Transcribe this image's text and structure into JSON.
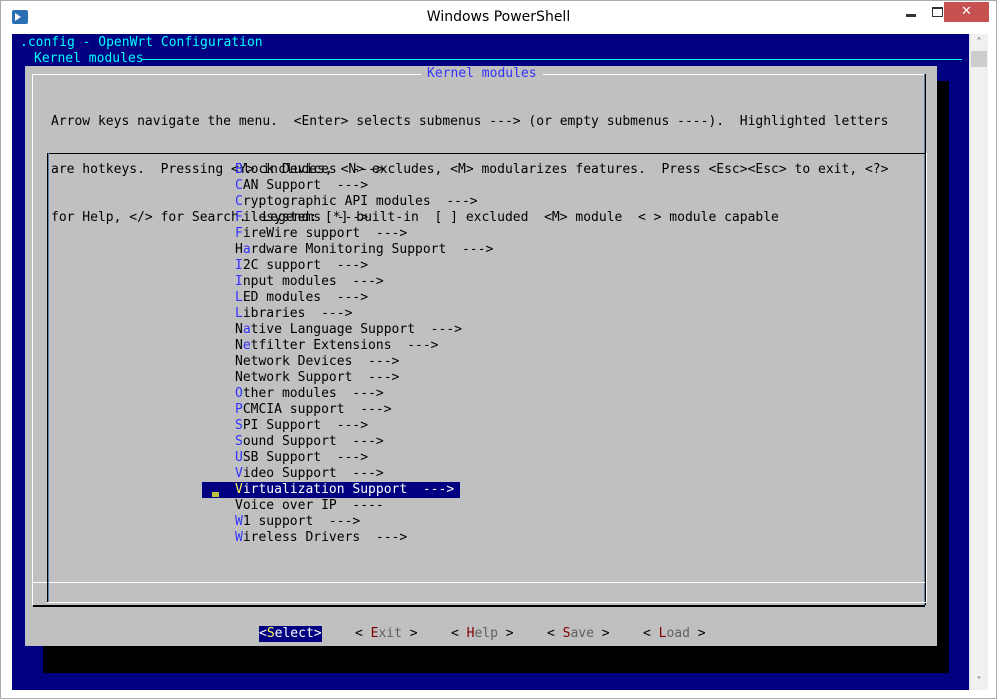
{
  "window": {
    "title": "Windows PowerShell",
    "controls": {
      "minimize": "minimize",
      "maximize": "maximize",
      "close": "✕"
    }
  },
  "console": {
    "header_line1": ".config - OpenWrt Configuration",
    "header_line2": "Kernel modules",
    "colors": {
      "background": "#000080",
      "header_text": "#00ffff",
      "dialog": "#c0c0c0",
      "hotkey": "#3333ff",
      "selected_bg": "#000080",
      "selected_hotkey": "#ffff55"
    }
  },
  "dialog": {
    "title": "Kernel modules",
    "help_lines": [
      "Arrow keys navigate the menu.  <Enter> selects submenus ---> (or empty submenus ----).  Highlighted letters",
      "are hotkeys.  Pressing <Y> includes, <N> excludes, <M> modularizes features.  Press <Esc><Esc> to exit, <?>",
      "for Help, </> for Search.  Legend: [*] built-in  [ ] excluded  <M> module  < > module capable"
    ],
    "menu_items": [
      {
        "pre": "",
        "hotkey": "B",
        "rest": "lock Devices  --->"
      },
      {
        "pre": "",
        "hotkey": "C",
        "rest": "AN Support  --->"
      },
      {
        "pre": "",
        "hotkey": "C",
        "rest": "ryptographic API modules  --->"
      },
      {
        "pre": "",
        "hotkey": "F",
        "rest": "ilesystems  --->"
      },
      {
        "pre": "",
        "hotkey": "F",
        "rest": "ireWire support  --->"
      },
      {
        "pre": "H",
        "hotkey": "a",
        "rest": "rdware Monitoring Support  --->"
      },
      {
        "pre": "",
        "hotkey": "I",
        "rest": "2C support  --->"
      },
      {
        "pre": "",
        "hotkey": "I",
        "rest": "nput modules  --->"
      },
      {
        "pre": "",
        "hotkey": "L",
        "rest": "ED modules  --->"
      },
      {
        "pre": "",
        "hotkey": "L",
        "rest": "ibraries  --->"
      },
      {
        "pre": "N",
        "hotkey": "a",
        "rest": "tive Language Support  --->"
      },
      {
        "pre": "N",
        "hotkey": "e",
        "rest": "tfilter Extensions  --->"
      },
      {
        "pre": "",
        "hotkey": "",
        "rest": "Network Devices  --->"
      },
      {
        "pre": "",
        "hotkey": "",
        "rest": "Network Support  --->"
      },
      {
        "pre": "",
        "hotkey": "O",
        "rest": "ther modules  --->"
      },
      {
        "pre": "",
        "hotkey": "P",
        "rest": "CMCIA support  --->"
      },
      {
        "pre": "",
        "hotkey": "S",
        "rest": "PI Support  --->"
      },
      {
        "pre": "",
        "hotkey": "S",
        "rest": "ound Support  --->"
      },
      {
        "pre": "",
        "hotkey": "U",
        "rest": "SB Support  --->"
      },
      {
        "pre": "",
        "hotkey": "V",
        "rest": "ideo Support  --->"
      },
      {
        "pre": "",
        "hotkey": "V",
        "rest": "irtualization Support  --->",
        "selected": true
      },
      {
        "pre": "",
        "hotkey": "",
        "rest": "Voice over IP  ----"
      },
      {
        "pre": "",
        "hotkey": "W",
        "rest": "1 support  --->"
      },
      {
        "pre": "",
        "hotkey": "W",
        "rest": "ireless Drivers  --->"
      }
    ],
    "buttons": [
      {
        "open": "<",
        "hotkey": "S",
        "rest": "elect",
        "close": ">",
        "active": true
      },
      {
        "open": "< ",
        "hotkey": "E",
        "rest": "xit",
        "close": " >"
      },
      {
        "open": "< ",
        "hotkey": "H",
        "rest": "elp",
        "close": " >"
      },
      {
        "open": "< ",
        "hotkey": "S",
        "rest": "ave",
        "close": " >"
      },
      {
        "open": "< ",
        "hotkey": "L",
        "rest": "oad",
        "close": " >"
      }
    ]
  },
  "scrollbar": {
    "up": "˄",
    "down": "˅"
  }
}
